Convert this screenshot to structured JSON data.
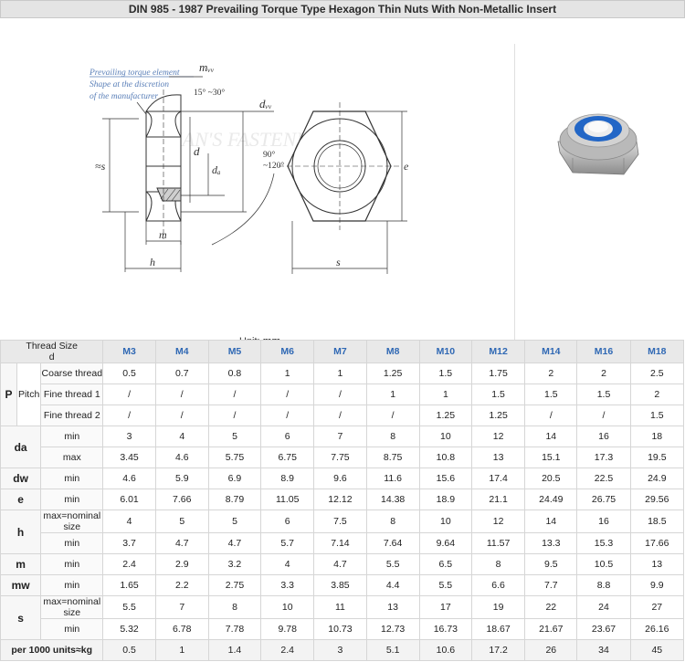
{
  "title": "DIN 985 - 1987 Prevailing Torque Type Hexagon Thin Nuts With Non-Metallic Insert",
  "figure": {
    "note_lines": [
      "Prevailing torque element",
      "Shape at the discretion",
      "of the manufacturer"
    ],
    "angle_chamfer": "15° ~30°",
    "angle_bearing_line1": "90°",
    "angle_bearing_line2": "~120°",
    "watermark": "TIAN'S FASTENER.com",
    "labels": {
      "mw": "mᵥᵥ",
      "dw": "dᵥᵥ",
      "d": "d",
      "da": "dₐ",
      "m": "m",
      "h": "h",
      "s_left": "≈s",
      "s_bottom": "s",
      "e": "e"
    },
    "unit_label": "Unit:",
    "unit_value": "mm"
  },
  "table": {
    "header_lines": [
      "Thread Size",
      "d"
    ],
    "sizes": [
      "M3",
      "M4",
      "M5",
      "M6",
      "M7",
      "M8",
      "M10",
      "M12",
      "M14",
      "M16",
      "M18"
    ],
    "pitch_group": {
      "label_p": "P",
      "label_pitch": "Pitch",
      "rows": [
        {
          "label": "Coarse thread",
          "values": [
            "0.5",
            "0.7",
            "0.8",
            "1",
            "1",
            "1.25",
            "1.5",
            "1.75",
            "2",
            "2",
            "2.5"
          ]
        },
        {
          "label": "Fine thread 1",
          "values": [
            "/",
            "/",
            "/",
            "/",
            "/",
            "1",
            "1",
            "1.5",
            "1.5",
            "1.5",
            "2"
          ]
        },
        {
          "label": "Fine thread 2",
          "values": [
            "/",
            "/",
            "/",
            "/",
            "/",
            "/",
            "1.25",
            "1.25",
            "/",
            "/",
            "1.5"
          ]
        }
      ]
    },
    "da": {
      "label": "da",
      "rows": [
        {
          "label": "min",
          "values": [
            "3",
            "4",
            "5",
            "6",
            "7",
            "8",
            "10",
            "12",
            "14",
            "16",
            "18"
          ]
        },
        {
          "label": "max",
          "values": [
            "3.45",
            "4.6",
            "5.75",
            "6.75",
            "7.75",
            "8.75",
            "10.8",
            "13",
            "15.1",
            "17.3",
            "19.5"
          ]
        }
      ]
    },
    "dw": {
      "label": "dw",
      "row_label": "min",
      "values": [
        "4.6",
        "5.9",
        "6.9",
        "8.9",
        "9.6",
        "11.6",
        "15.6",
        "17.4",
        "20.5",
        "22.5",
        "24.9"
      ]
    },
    "e": {
      "label": "e",
      "row_label": "min",
      "values": [
        "6.01",
        "7.66",
        "8.79",
        "11.05",
        "12.12",
        "14.38",
        "18.9",
        "21.1",
        "24.49",
        "26.75",
        "29.56"
      ]
    },
    "h": {
      "label": "h",
      "rows": [
        {
          "label": "max=nominal size",
          "values": [
            "4",
            "5",
            "5",
            "6",
            "7.5",
            "8",
            "10",
            "12",
            "14",
            "16",
            "18.5"
          ]
        },
        {
          "label": "min",
          "values": [
            "3.7",
            "4.7",
            "4.7",
            "5.7",
            "7.14",
            "7.64",
            "9.64",
            "11.57",
            "13.3",
            "15.3",
            "17.66"
          ]
        }
      ]
    },
    "m": {
      "label": "m",
      "row_label": "min",
      "values": [
        "2.4",
        "2.9",
        "3.2",
        "4",
        "4.7",
        "5.5",
        "6.5",
        "8",
        "9.5",
        "10.5",
        "13"
      ]
    },
    "mw": {
      "label": "mw",
      "row_label": "min",
      "values": [
        "1.65",
        "2.2",
        "2.75",
        "3.3",
        "3.85",
        "4.4",
        "5.5",
        "6.6",
        "7.7",
        "8.8",
        "9.9"
      ]
    },
    "s": {
      "label": "s",
      "rows": [
        {
          "label": "max=nominal size",
          "values": [
            "5.5",
            "7",
            "8",
            "10",
            "11",
            "13",
            "17",
            "19",
            "22",
            "24",
            "27"
          ]
        },
        {
          "label": "min",
          "values": [
            "5.32",
            "6.78",
            "7.78",
            "9.78",
            "10.73",
            "12.73",
            "16.73",
            "18.67",
            "21.67",
            "23.67",
            "26.16"
          ]
        }
      ]
    },
    "weight": {
      "label": "per 1000 units≈kg",
      "values": [
        "0.5",
        "1",
        "1.4",
        "2.4",
        "3",
        "5.1",
        "10.6",
        "17.2",
        "26",
        "34",
        "45"
      ]
    }
  }
}
